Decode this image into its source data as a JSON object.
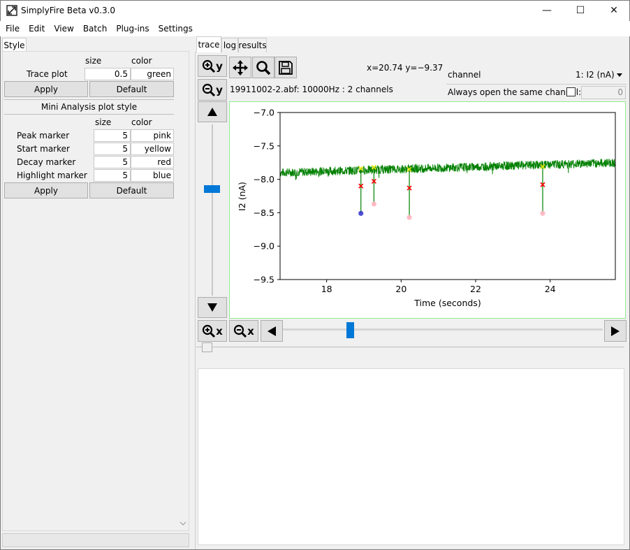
{
  "window": {
    "title": "SimplyFire Beta v0.3.0",
    "controls": {
      "minimize": "—",
      "maximize": "☐",
      "close": "✕"
    }
  },
  "menu": [
    "File",
    "Edit",
    "View",
    "Batch",
    "Plug-ins",
    "Settings"
  ],
  "left_panel": {
    "tab": "Style",
    "col_size": "size",
    "col_color": "color",
    "trace_plot": {
      "label": "Trace plot",
      "size": "0.5",
      "color": "green"
    },
    "apply_label": "Apply",
    "default_label": "Default",
    "mini_title": "Mini Analysis plot style",
    "markers": [
      {
        "label": "Peak marker",
        "size": "5",
        "color": "pink"
      },
      {
        "label": "Start marker",
        "size": "5",
        "color": "yellow"
      },
      {
        "label": "Decay marker",
        "size": "5",
        "color": "red"
      },
      {
        "label": "Highlight marker",
        "size": "5",
        "color": "blue"
      }
    ]
  },
  "right_tabs": [
    "trace",
    "log",
    "results"
  ],
  "toolbar": {
    "zoom_in_y": "y",
    "zoom_out_y": "y",
    "zoom_in_x": "x",
    "zoom_out_x": "x",
    "coords": "x=20.74  y=−9.37",
    "file_info": "19911002-2.abf: 10000Hz : 2 channels"
  },
  "channel": {
    "label": "channel",
    "value": "1: I2 (nA)",
    "always_open_label": "Always open the same channel:",
    "always_open_value": "0"
  },
  "chart_data": {
    "type": "line",
    "xlabel": "Time (seconds)",
    "ylabel": "I2 (nA)",
    "xlim": [
      16.75,
      25.75
    ],
    "ylim": [
      -9.5,
      -7.0
    ],
    "x_ticks": [
      18,
      20,
      22,
      24
    ],
    "y_ticks": [
      -7.0,
      -7.5,
      -8.0,
      -8.5,
      -9.0,
      -9.5
    ],
    "series": [
      {
        "color": "#008000",
        "baseline_start": -7.9,
        "baseline_end": -7.75
      }
    ],
    "events": [
      {
        "peak_x": 18.92,
        "peak_y": -8.51,
        "start_y": -7.84,
        "decay_y": -8.1,
        "highlight": true
      },
      {
        "peak_x": 19.27,
        "peak_y": -8.37,
        "start_y": -7.82,
        "decay_y": -8.03,
        "highlight": false
      },
      {
        "peak_x": 20.22,
        "peak_y": -8.57,
        "start_y": -7.85,
        "decay_y": -8.13,
        "highlight": false
      },
      {
        "peak_x": 23.8,
        "peak_y": -8.51,
        "start_y": -7.81,
        "decay_y": -8.08,
        "highlight": false
      }
    ],
    "marker_colors": {
      "trace": "#008000",
      "peak": "#ffb6c1",
      "start": "#e8e800",
      "decay": "#ff0000",
      "highlight": "#3333cc"
    }
  }
}
